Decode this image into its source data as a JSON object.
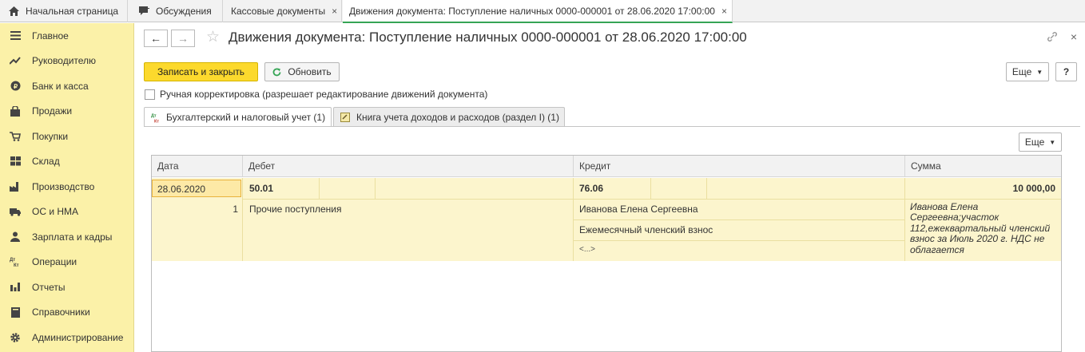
{
  "top_tabs": [
    {
      "label": "Начальная страница",
      "icon": "home-icon"
    },
    {
      "label": "Обсуждения",
      "icon": "chat-icon"
    },
    {
      "label": "Кассовые документы",
      "close": "×"
    },
    {
      "label": "Движения документа: Поступление наличных 0000-000001 от 28.06.2020 17:00:00",
      "close": "×"
    }
  ],
  "sidebar": {
    "items": [
      {
        "label": "Главное",
        "icon": "menu-icon"
      },
      {
        "label": "Руководителю",
        "icon": "trend-icon"
      },
      {
        "label": "Банк и касса",
        "icon": "coin-icon"
      },
      {
        "label": "Продажи",
        "icon": "bag-icon"
      },
      {
        "label": "Покупки",
        "icon": "cart-icon"
      },
      {
        "label": "Склад",
        "icon": "warehouse-icon"
      },
      {
        "label": "Производство",
        "icon": "factory-icon"
      },
      {
        "label": "ОС и НМА",
        "icon": "truck-icon"
      },
      {
        "label": "Зарплата и кадры",
        "icon": "person-icon"
      },
      {
        "label": "Операции",
        "icon": "dtkt-icon"
      },
      {
        "label": "Отчеты",
        "icon": "bar-chart-icon"
      },
      {
        "label": "Справочники",
        "icon": "book-icon"
      },
      {
        "label": "Администрирование",
        "icon": "gear-icon"
      }
    ]
  },
  "window": {
    "back": "←",
    "forward": "→",
    "star": "☆",
    "title": "Движения документа: Поступление наличных 0000-000001 от 28.06.2020 17:00:00",
    "close": "×"
  },
  "toolbar": {
    "save_close": "Записать и закрыть",
    "refresh": "Обновить",
    "more": "Еще",
    "help": "?"
  },
  "manual_edit": {
    "label": "Ручная корректировка (разрешает редактирование движений документа)",
    "checked": false
  },
  "doc_tabs": [
    {
      "label": "Бухгалтерский и налоговый учет (1)",
      "icon": "dtkt-icon",
      "active": true
    },
    {
      "label": "Книга учета доходов и расходов (раздел I) (1)",
      "icon": "book-ledger-icon",
      "active": false
    }
  ],
  "table": {
    "more": "Еще",
    "columns": [
      "Дата",
      "Дебет",
      "Кредит",
      "Сумма"
    ],
    "rows": [
      {
        "date": "28.06.2020",
        "line_no": "1",
        "debit_account": "50.01",
        "debit_sub1": "Прочие поступления",
        "credit_account": "76.06",
        "credit_sub1": "Иванова Елена Сергеевна",
        "credit_sub2": "Ежемесячный членский взнос",
        "credit_sub3": "<...>",
        "amount": "10 000,00",
        "content": "Иванова Елена Сергеевна;участок 112,ежеквартальный членский взнос за Июль 2020 г. НДС не облагается"
      }
    ]
  },
  "colors": {
    "sidebar_bg": "#fbf1a8",
    "primary_button": "#fcd92d",
    "selected_row": "#fcf5cd",
    "active_tab_underline": "#35a555"
  }
}
